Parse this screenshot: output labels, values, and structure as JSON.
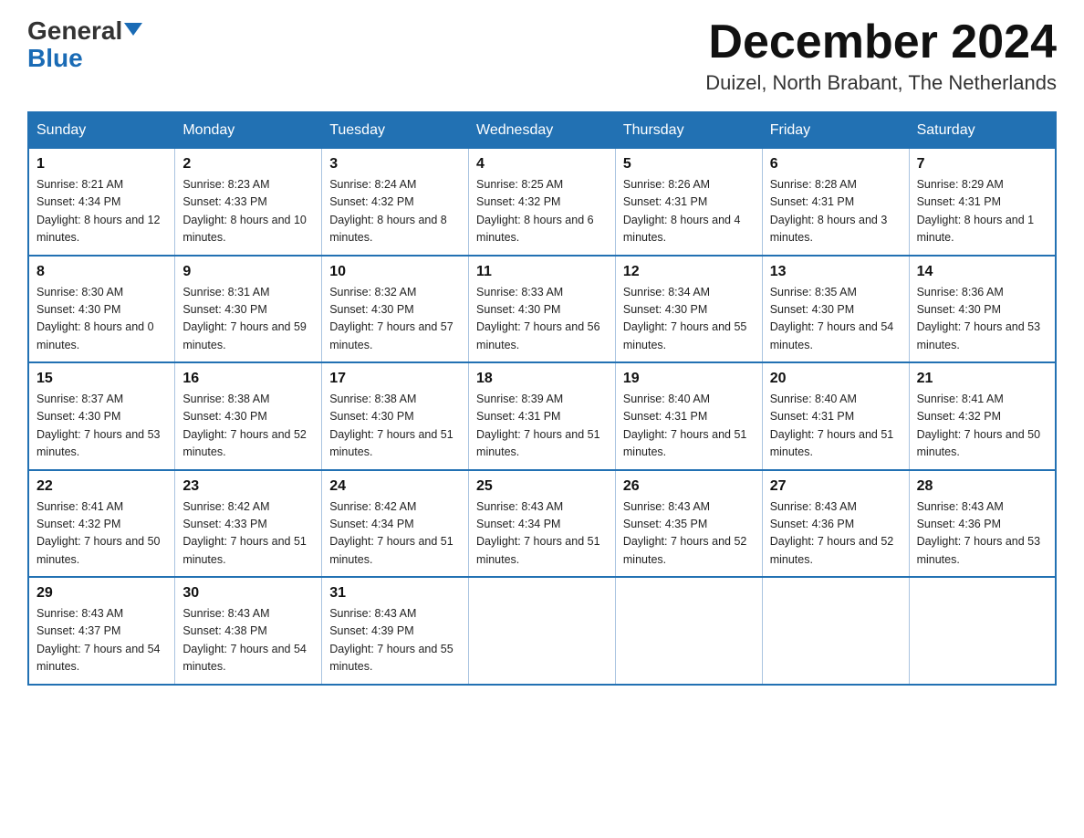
{
  "header": {
    "logo_line1": "General",
    "logo_line2": "Blue",
    "month_title": "December 2024",
    "location": "Duizel, North Brabant, The Netherlands"
  },
  "weekdays": [
    "Sunday",
    "Monday",
    "Tuesday",
    "Wednesday",
    "Thursday",
    "Friday",
    "Saturday"
  ],
  "weeks": [
    [
      {
        "day": "1",
        "sunrise": "8:21 AM",
        "sunset": "4:34 PM",
        "daylight": "8 hours and 12 minutes."
      },
      {
        "day": "2",
        "sunrise": "8:23 AM",
        "sunset": "4:33 PM",
        "daylight": "8 hours and 10 minutes."
      },
      {
        "day": "3",
        "sunrise": "8:24 AM",
        "sunset": "4:32 PM",
        "daylight": "8 hours and 8 minutes."
      },
      {
        "day": "4",
        "sunrise": "8:25 AM",
        "sunset": "4:32 PM",
        "daylight": "8 hours and 6 minutes."
      },
      {
        "day": "5",
        "sunrise": "8:26 AM",
        "sunset": "4:31 PM",
        "daylight": "8 hours and 4 minutes."
      },
      {
        "day": "6",
        "sunrise": "8:28 AM",
        "sunset": "4:31 PM",
        "daylight": "8 hours and 3 minutes."
      },
      {
        "day": "7",
        "sunrise": "8:29 AM",
        "sunset": "4:31 PM",
        "daylight": "8 hours and 1 minute."
      }
    ],
    [
      {
        "day": "8",
        "sunrise": "8:30 AM",
        "sunset": "4:30 PM",
        "daylight": "8 hours and 0 minutes."
      },
      {
        "day": "9",
        "sunrise": "8:31 AM",
        "sunset": "4:30 PM",
        "daylight": "7 hours and 59 minutes."
      },
      {
        "day": "10",
        "sunrise": "8:32 AM",
        "sunset": "4:30 PM",
        "daylight": "7 hours and 57 minutes."
      },
      {
        "day": "11",
        "sunrise": "8:33 AM",
        "sunset": "4:30 PM",
        "daylight": "7 hours and 56 minutes."
      },
      {
        "day": "12",
        "sunrise": "8:34 AM",
        "sunset": "4:30 PM",
        "daylight": "7 hours and 55 minutes."
      },
      {
        "day": "13",
        "sunrise": "8:35 AM",
        "sunset": "4:30 PM",
        "daylight": "7 hours and 54 minutes."
      },
      {
        "day": "14",
        "sunrise": "8:36 AM",
        "sunset": "4:30 PM",
        "daylight": "7 hours and 53 minutes."
      }
    ],
    [
      {
        "day": "15",
        "sunrise": "8:37 AM",
        "sunset": "4:30 PM",
        "daylight": "7 hours and 53 minutes."
      },
      {
        "day": "16",
        "sunrise": "8:38 AM",
        "sunset": "4:30 PM",
        "daylight": "7 hours and 52 minutes."
      },
      {
        "day": "17",
        "sunrise": "8:38 AM",
        "sunset": "4:30 PM",
        "daylight": "7 hours and 51 minutes."
      },
      {
        "day": "18",
        "sunrise": "8:39 AM",
        "sunset": "4:31 PM",
        "daylight": "7 hours and 51 minutes."
      },
      {
        "day": "19",
        "sunrise": "8:40 AM",
        "sunset": "4:31 PM",
        "daylight": "7 hours and 51 minutes."
      },
      {
        "day": "20",
        "sunrise": "8:40 AM",
        "sunset": "4:31 PM",
        "daylight": "7 hours and 51 minutes."
      },
      {
        "day": "21",
        "sunrise": "8:41 AM",
        "sunset": "4:32 PM",
        "daylight": "7 hours and 50 minutes."
      }
    ],
    [
      {
        "day": "22",
        "sunrise": "8:41 AM",
        "sunset": "4:32 PM",
        "daylight": "7 hours and 50 minutes."
      },
      {
        "day": "23",
        "sunrise": "8:42 AM",
        "sunset": "4:33 PM",
        "daylight": "7 hours and 51 minutes."
      },
      {
        "day": "24",
        "sunrise": "8:42 AM",
        "sunset": "4:34 PM",
        "daylight": "7 hours and 51 minutes."
      },
      {
        "day": "25",
        "sunrise": "8:43 AM",
        "sunset": "4:34 PM",
        "daylight": "7 hours and 51 minutes."
      },
      {
        "day": "26",
        "sunrise": "8:43 AM",
        "sunset": "4:35 PM",
        "daylight": "7 hours and 52 minutes."
      },
      {
        "day": "27",
        "sunrise": "8:43 AM",
        "sunset": "4:36 PM",
        "daylight": "7 hours and 52 minutes."
      },
      {
        "day": "28",
        "sunrise": "8:43 AM",
        "sunset": "4:36 PM",
        "daylight": "7 hours and 53 minutes."
      }
    ],
    [
      {
        "day": "29",
        "sunrise": "8:43 AM",
        "sunset": "4:37 PM",
        "daylight": "7 hours and 54 minutes."
      },
      {
        "day": "30",
        "sunrise": "8:43 AM",
        "sunset": "4:38 PM",
        "daylight": "7 hours and 54 minutes."
      },
      {
        "day": "31",
        "sunrise": "8:43 AM",
        "sunset": "4:39 PM",
        "daylight": "7 hours and 55 minutes."
      },
      null,
      null,
      null,
      null
    ]
  ]
}
